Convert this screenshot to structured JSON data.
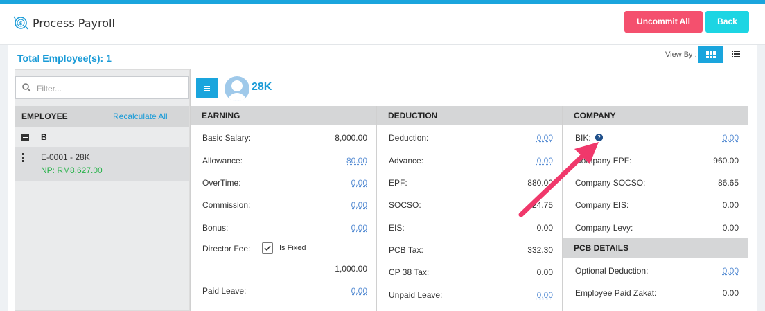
{
  "header": {
    "title": "Process Payroll",
    "uncommit_label": "Uncommit All",
    "back_label": "Back"
  },
  "toolbar": {
    "total_label": "Total Employee(s): 1",
    "view_by_label": "View By :"
  },
  "filter": {
    "placeholder": "Filter..."
  },
  "employee_list": {
    "header": "EMPLOYEE",
    "recalculate_label": "Recalculate All",
    "group_name": "B",
    "items": [
      {
        "code": "E-0001 - 28K",
        "net_pay": "NP: RM8,627.00"
      }
    ]
  },
  "employee": {
    "name": "28K"
  },
  "earning": {
    "title": "EARNING",
    "rows": [
      {
        "label": "Basic Salary:",
        "value": "8,000.00"
      },
      {
        "label": "Allowance:",
        "value": "80.00"
      },
      {
        "label": "OverTime:",
        "value": "0.00"
      },
      {
        "label": "Commission:",
        "value": "0.00"
      },
      {
        "label": "Bonus:",
        "value": "0.00"
      },
      {
        "label": "Director Fee:",
        "value": "1,000.00"
      },
      {
        "label": "Paid Leave:",
        "value": "0.00"
      }
    ],
    "is_fixed_label": "Is Fixed"
  },
  "deduction": {
    "title": "DEDUCTION",
    "rows": [
      {
        "label": "Deduction:",
        "value": "0.00"
      },
      {
        "label": "Advance:",
        "value": "0.00"
      },
      {
        "label": "EPF:",
        "value": "880.00"
      },
      {
        "label": "SOCSO:",
        "value": "24.75"
      },
      {
        "label": "EIS:",
        "value": "0.00"
      },
      {
        "label": "PCB Tax:",
        "value": "332.30"
      },
      {
        "label": "CP 38 Tax:",
        "value": "0.00"
      },
      {
        "label": "Unpaid Leave:",
        "value": "0.00"
      }
    ]
  },
  "company": {
    "title": "COMPANY",
    "rows": [
      {
        "label": "BIK:",
        "value": "0.00"
      },
      {
        "label": "Company EPF:",
        "value": "960.00"
      },
      {
        "label": "Company SOCSO:",
        "value": "86.65"
      },
      {
        "label": "Company EIS:",
        "value": "0.00"
      },
      {
        "label": "Company Levy:",
        "value": "0.00"
      }
    ]
  },
  "pcb_details": {
    "title": "PCB DETAILS",
    "rows": [
      {
        "label": "Optional Deduction:",
        "value": "0.00"
      },
      {
        "label": "Employee Paid Zakat:",
        "value": "0.00"
      }
    ]
  },
  "colors": {
    "accent": "#1aa5dd",
    "danger": "#f4506e",
    "cyan": "#1dd5e3",
    "success": "#27b24a",
    "annotation": "#f0386b"
  },
  "icons": [
    "payroll-logo-icon",
    "grid-view-icon",
    "list-view-icon",
    "search-icon",
    "collapse-icon",
    "row-menu-icon",
    "menu-icon",
    "avatar-icon",
    "checkbox-checked-icon",
    "help-icon",
    "annotation-arrow-icon"
  ]
}
